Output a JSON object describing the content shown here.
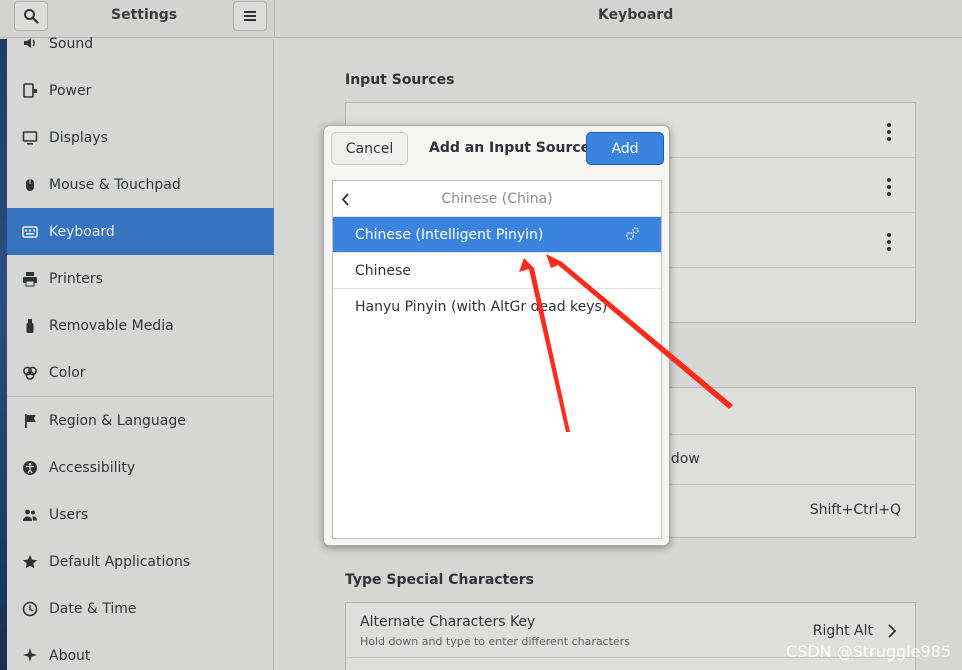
{
  "header": {
    "app_title": "Settings",
    "panel_title": "Keyboard",
    "search_icon": "search-icon",
    "menu_icon": "hamburger-menu-icon"
  },
  "sidebar": {
    "items": [
      {
        "label": "Sound",
        "icon": "speaker-icon"
      },
      {
        "label": "Power",
        "icon": "power-plug-icon"
      },
      {
        "label": "Displays",
        "icon": "display-icon"
      },
      {
        "label": "Mouse & Touchpad",
        "icon": "mouse-icon"
      },
      {
        "label": "Keyboard",
        "icon": "keyboard-icon",
        "active": true
      },
      {
        "label": "Printers",
        "icon": "printer-icon"
      },
      {
        "label": "Removable Media",
        "icon": "usb-drive-icon"
      },
      {
        "label": "Color",
        "icon": "color-icon"
      },
      {
        "label": "Region & Language",
        "icon": "flag-icon"
      },
      {
        "label": "Accessibility",
        "icon": "accessibility-icon"
      },
      {
        "label": "Users",
        "icon": "users-icon"
      },
      {
        "label": "Default Applications",
        "icon": "star-icon"
      },
      {
        "label": "Date & Time",
        "icon": "clock-icon"
      },
      {
        "label": "About",
        "icon": "sparkle-icon"
      }
    ]
  },
  "main": {
    "input_sources_title": "Input Sources",
    "shortcut_partial_text": "ndow",
    "shortcut_value": "Shift+Ctrl+Q",
    "type_special_title": "Type Special Characters",
    "alternate_key": {
      "title": "Alternate Characters Key",
      "subtitle": "Hold down and type to enter different characters",
      "value": "Right Alt"
    }
  },
  "dialog": {
    "cancel_label": "Cancel",
    "title": "Add an Input Source",
    "add_label": "Add",
    "category": "Chinese (China)",
    "options": [
      {
        "label": "Chinese (Intelligent Pinyin)",
        "selected": true,
        "has_settings": true
      },
      {
        "label": "Chinese",
        "selected": false
      },
      {
        "label": "Hanyu Pinyin (with AltGr dead keys)",
        "selected": false
      }
    ]
  },
  "watermark": "CSDN @Struggle985",
  "colors": {
    "accent": "#3a84e0",
    "sidebar_active": "#3773bf",
    "annotation_arrow": "#ff2a1a"
  }
}
